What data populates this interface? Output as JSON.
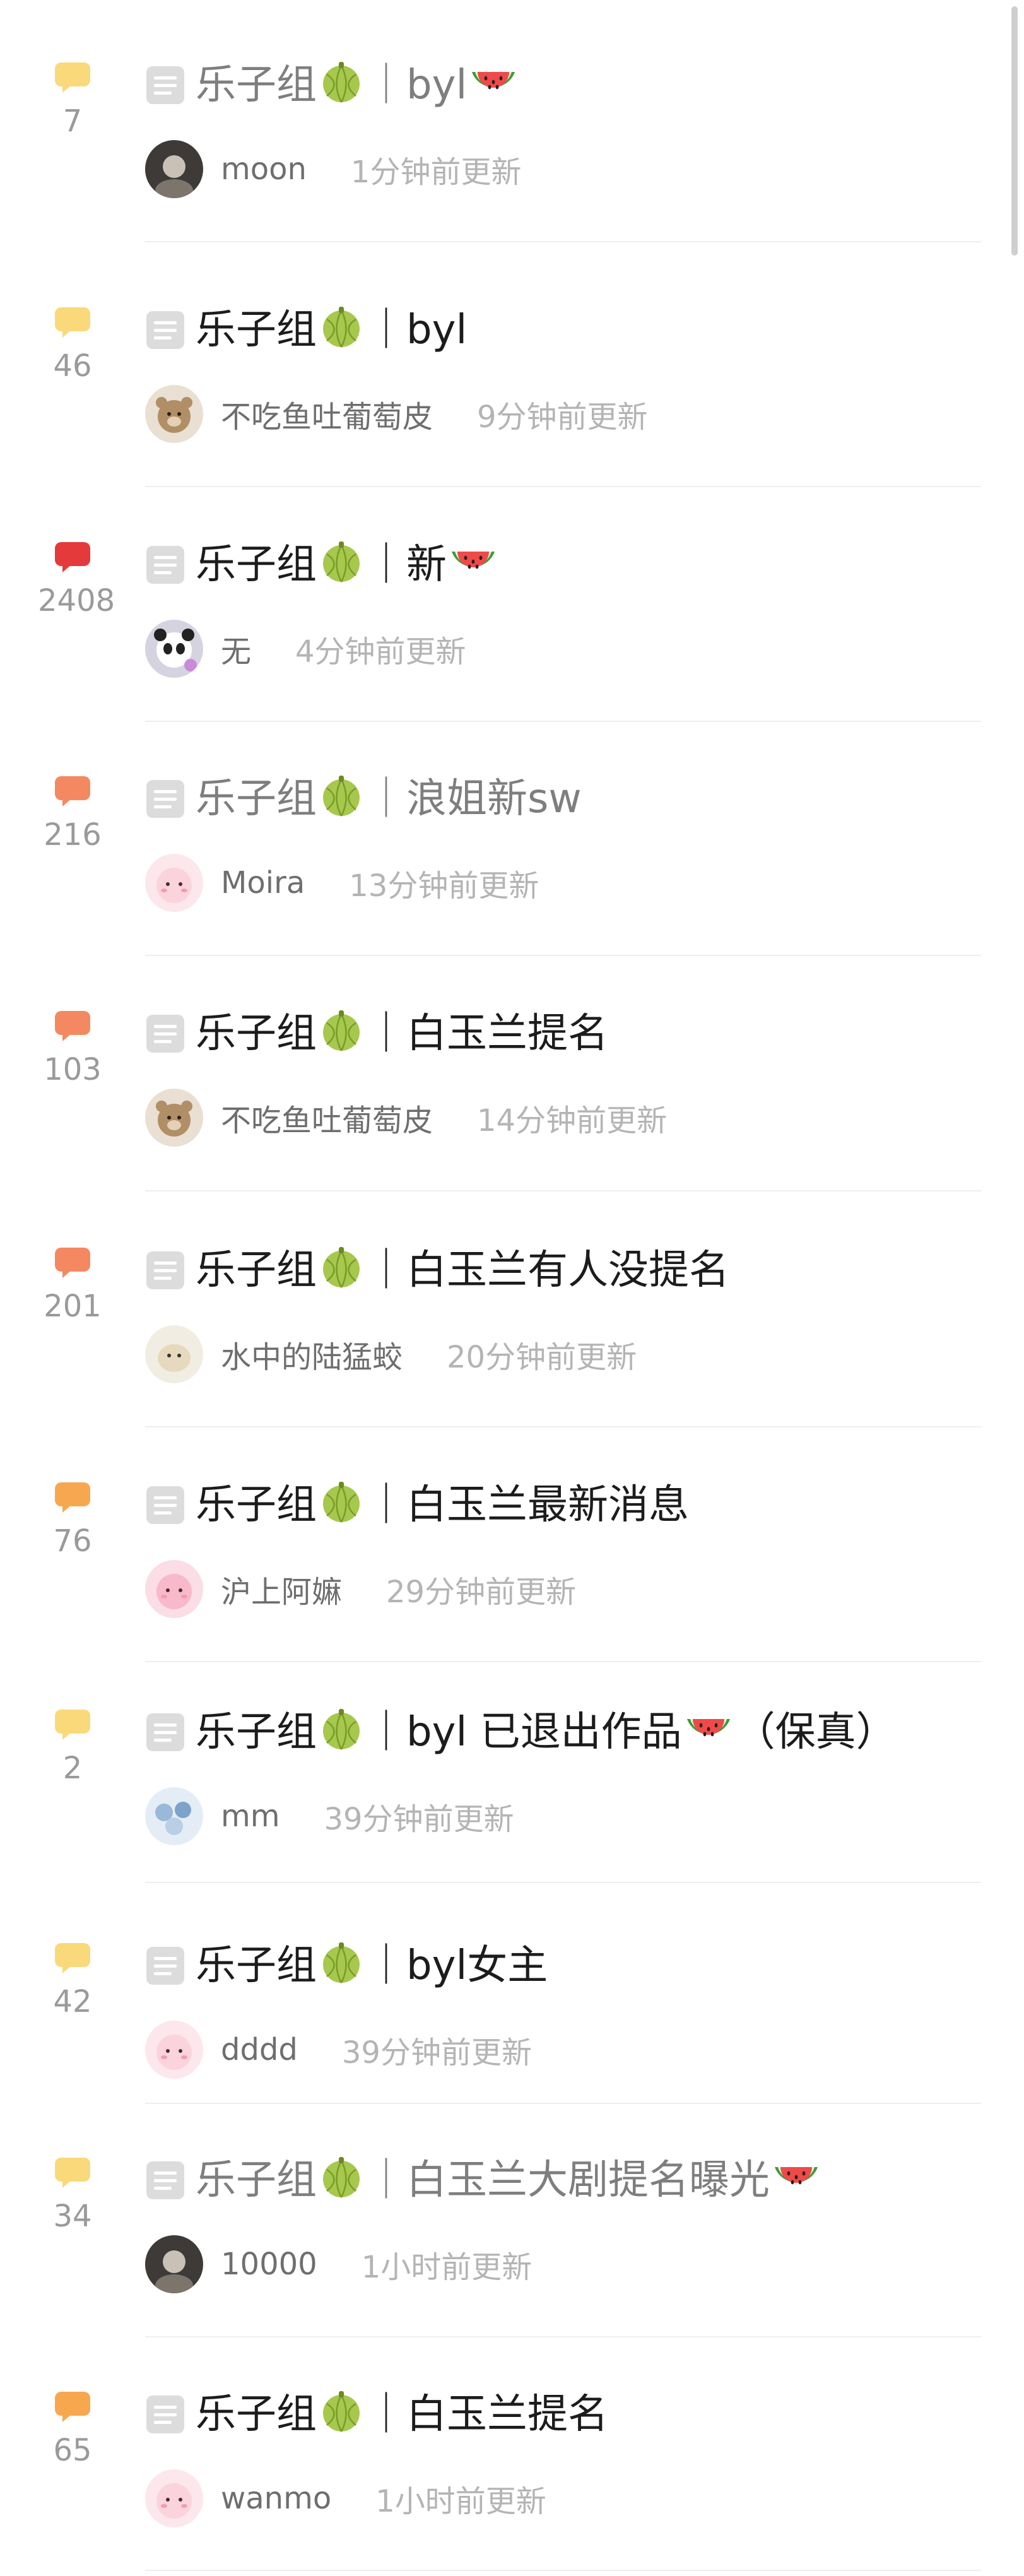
{
  "forum": {
    "threads": [
      {
        "count": "7",
        "count_level": "low",
        "title": "乐子组🍈｜byl🍉",
        "read": true,
        "author": "moon",
        "time": "1分钟前更新",
        "avatar": "dark"
      },
      {
        "count": "46",
        "count_level": "low",
        "title": "乐子组🍈｜byl",
        "read": false,
        "author": "不吃鱼吐葡萄皮",
        "time": "9分钟前更新",
        "avatar": "bear"
      },
      {
        "count": "2408",
        "count_level": "hot",
        "title": "乐子组🍈｜新🍉",
        "read": false,
        "author": "无",
        "time": "4分钟前更新",
        "avatar": "panda"
      },
      {
        "count": "216",
        "count_level": "high",
        "title": "乐子组🍈｜浪姐新sw",
        "read": true,
        "author": "Moira",
        "time": "13分钟前更新",
        "avatar": "pink"
      },
      {
        "count": "103",
        "count_level": "high",
        "title": "乐子组🍈｜白玉兰提名",
        "read": false,
        "author": "不吃鱼吐葡萄皮",
        "time": "14分钟前更新",
        "avatar": "bear"
      },
      {
        "count": "201",
        "count_level": "high",
        "title": "乐子组🍈｜白玉兰有人没提名",
        "read": false,
        "author": "水中的陆猛蛟",
        "time": "20分钟前更新",
        "avatar": "beige"
      },
      {
        "count": "76",
        "count_level": "mid",
        "title": "乐子组🍈｜白玉兰最新消息",
        "read": false,
        "author": "沪上阿嫲",
        "time": "29分钟前更新",
        "avatar": "pinkgirl"
      },
      {
        "count": "2",
        "count_level": "low",
        "title": "乐子组🍈｜byl 已退出作品🍉（保真）",
        "read": false,
        "author": "mm",
        "time": "39分钟前更新",
        "avatar": "blue"
      },
      {
        "count": "42",
        "count_level": "low",
        "title": "乐子组🍈｜byl女主",
        "read": false,
        "author": "dddd",
        "time": "39分钟前更新",
        "avatar": "pink"
      },
      {
        "count": "34",
        "count_level": "low",
        "title": "乐子组🍈｜白玉兰大剧提名曝光🍉",
        "read": true,
        "author": "10000",
        "time": "1小时前更新",
        "avatar": "dark"
      },
      {
        "count": "65",
        "count_level": "mid",
        "title": "乐子组🍈｜白玉兰提名",
        "read": false,
        "author": "wanmo",
        "time": "1小时前更新",
        "avatar": "pink"
      }
    ]
  },
  "colors": {
    "low": "#f9d979",
    "mid": "#f7a84f",
    "high": "#f48860",
    "hot": "#e43a3c"
  },
  "icons": {
    "doc": "document-icon",
    "melon": "melon-emoji",
    "watermelon": "watermelon-emoji"
  }
}
